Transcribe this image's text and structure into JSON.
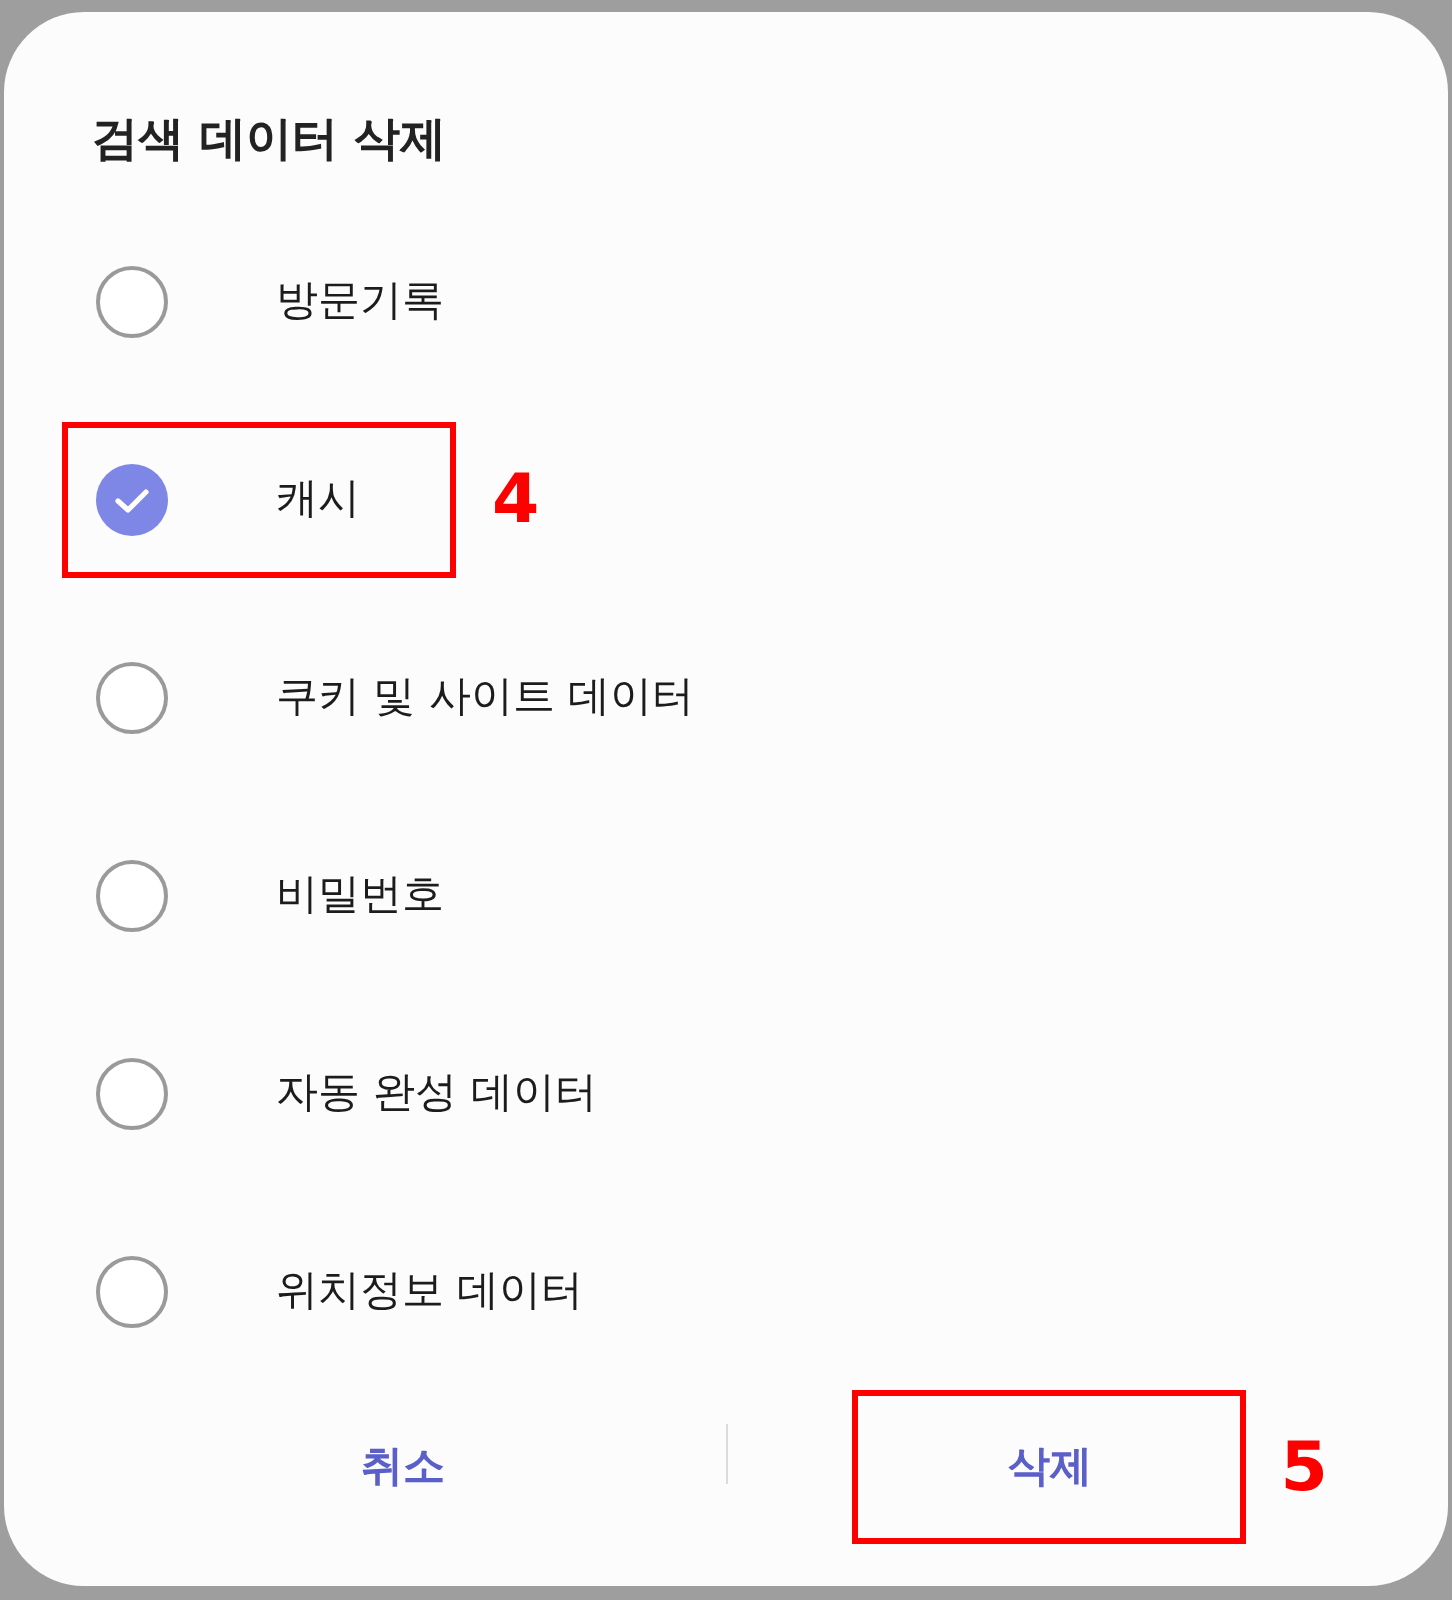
{
  "dialog": {
    "title": "검색 데이터 삭제",
    "options": [
      {
        "label": "방문기록",
        "checked": false
      },
      {
        "label": "캐시",
        "checked": true,
        "callout": "4"
      },
      {
        "label": "쿠키 및 사이트 데이터",
        "checked": false
      },
      {
        "label": "비밀번호",
        "checked": false
      },
      {
        "label": "자동 완성 데이터",
        "checked": false
      },
      {
        "label": "위치정보 데이터",
        "checked": false
      }
    ],
    "buttons": [
      {
        "label": "취소"
      },
      {
        "label": "삭제",
        "callout": "5"
      }
    ]
  }
}
